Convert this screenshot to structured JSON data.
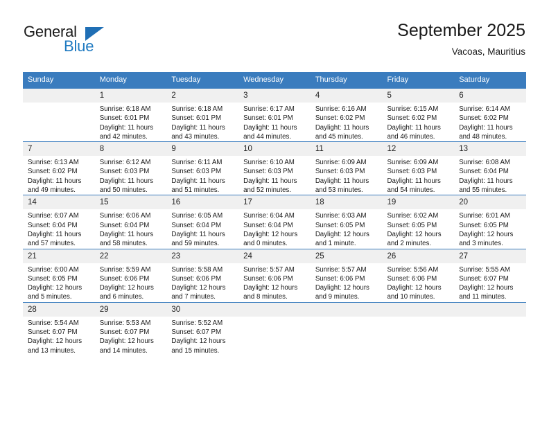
{
  "brand": {
    "word_one": "General",
    "word_two": "Blue",
    "triangle_color": "#1f6fb5",
    "blue_text_color": "#1f7ac1"
  },
  "header": {
    "title": "September 2025",
    "location": "Vacoas, Mauritius"
  },
  "theme": {
    "header_blue": "#3a7cbe",
    "daynum_band": "#f0f0f0",
    "text": "#1a1a1a"
  },
  "weekdays": [
    "Sunday",
    "Monday",
    "Tuesday",
    "Wednesday",
    "Thursday",
    "Friday",
    "Saturday"
  ],
  "weeks": [
    [
      {
        "day": "",
        "blank": true,
        "sunrise": "",
        "sunset": "",
        "daylight": ""
      },
      {
        "day": "1",
        "sunrise": "Sunrise: 6:18 AM",
        "sunset": "Sunset: 6:01 PM",
        "daylight": "Daylight: 11 hours and 42 minutes."
      },
      {
        "day": "2",
        "sunrise": "Sunrise: 6:18 AM",
        "sunset": "Sunset: 6:01 PM",
        "daylight": "Daylight: 11 hours and 43 minutes."
      },
      {
        "day": "3",
        "sunrise": "Sunrise: 6:17 AM",
        "sunset": "Sunset: 6:01 PM",
        "daylight": "Daylight: 11 hours and 44 minutes."
      },
      {
        "day": "4",
        "sunrise": "Sunrise: 6:16 AM",
        "sunset": "Sunset: 6:02 PM",
        "daylight": "Daylight: 11 hours and 45 minutes."
      },
      {
        "day": "5",
        "sunrise": "Sunrise: 6:15 AM",
        "sunset": "Sunset: 6:02 PM",
        "daylight": "Daylight: 11 hours and 46 minutes."
      },
      {
        "day": "6",
        "sunrise": "Sunrise: 6:14 AM",
        "sunset": "Sunset: 6:02 PM",
        "daylight": "Daylight: 11 hours and 48 minutes."
      }
    ],
    [
      {
        "day": "7",
        "sunrise": "Sunrise: 6:13 AM",
        "sunset": "Sunset: 6:02 PM",
        "daylight": "Daylight: 11 hours and 49 minutes."
      },
      {
        "day": "8",
        "sunrise": "Sunrise: 6:12 AM",
        "sunset": "Sunset: 6:03 PM",
        "daylight": "Daylight: 11 hours and 50 minutes."
      },
      {
        "day": "9",
        "sunrise": "Sunrise: 6:11 AM",
        "sunset": "Sunset: 6:03 PM",
        "daylight": "Daylight: 11 hours and 51 minutes."
      },
      {
        "day": "10",
        "sunrise": "Sunrise: 6:10 AM",
        "sunset": "Sunset: 6:03 PM",
        "daylight": "Daylight: 11 hours and 52 minutes."
      },
      {
        "day": "11",
        "sunrise": "Sunrise: 6:09 AM",
        "sunset": "Sunset: 6:03 PM",
        "daylight": "Daylight: 11 hours and 53 minutes."
      },
      {
        "day": "12",
        "sunrise": "Sunrise: 6:09 AM",
        "sunset": "Sunset: 6:03 PM",
        "daylight": "Daylight: 11 hours and 54 minutes."
      },
      {
        "day": "13",
        "sunrise": "Sunrise: 6:08 AM",
        "sunset": "Sunset: 6:04 PM",
        "daylight": "Daylight: 11 hours and 55 minutes."
      }
    ],
    [
      {
        "day": "14",
        "sunrise": "Sunrise: 6:07 AM",
        "sunset": "Sunset: 6:04 PM",
        "daylight": "Daylight: 11 hours and 57 minutes."
      },
      {
        "day": "15",
        "sunrise": "Sunrise: 6:06 AM",
        "sunset": "Sunset: 6:04 PM",
        "daylight": "Daylight: 11 hours and 58 minutes."
      },
      {
        "day": "16",
        "sunrise": "Sunrise: 6:05 AM",
        "sunset": "Sunset: 6:04 PM",
        "daylight": "Daylight: 11 hours and 59 minutes."
      },
      {
        "day": "17",
        "sunrise": "Sunrise: 6:04 AM",
        "sunset": "Sunset: 6:04 PM",
        "daylight": "Daylight: 12 hours and 0 minutes."
      },
      {
        "day": "18",
        "sunrise": "Sunrise: 6:03 AM",
        "sunset": "Sunset: 6:05 PM",
        "daylight": "Daylight: 12 hours and 1 minute."
      },
      {
        "day": "19",
        "sunrise": "Sunrise: 6:02 AM",
        "sunset": "Sunset: 6:05 PM",
        "daylight": "Daylight: 12 hours and 2 minutes."
      },
      {
        "day": "20",
        "sunrise": "Sunrise: 6:01 AM",
        "sunset": "Sunset: 6:05 PM",
        "daylight": "Daylight: 12 hours and 3 minutes."
      }
    ],
    [
      {
        "day": "21",
        "sunrise": "Sunrise: 6:00 AM",
        "sunset": "Sunset: 6:05 PM",
        "daylight": "Daylight: 12 hours and 5 minutes."
      },
      {
        "day": "22",
        "sunrise": "Sunrise: 5:59 AM",
        "sunset": "Sunset: 6:06 PM",
        "daylight": "Daylight: 12 hours and 6 minutes."
      },
      {
        "day": "23",
        "sunrise": "Sunrise: 5:58 AM",
        "sunset": "Sunset: 6:06 PM",
        "daylight": "Daylight: 12 hours and 7 minutes."
      },
      {
        "day": "24",
        "sunrise": "Sunrise: 5:57 AM",
        "sunset": "Sunset: 6:06 PM",
        "daylight": "Daylight: 12 hours and 8 minutes."
      },
      {
        "day": "25",
        "sunrise": "Sunrise: 5:57 AM",
        "sunset": "Sunset: 6:06 PM",
        "daylight": "Daylight: 12 hours and 9 minutes."
      },
      {
        "day": "26",
        "sunrise": "Sunrise: 5:56 AM",
        "sunset": "Sunset: 6:06 PM",
        "daylight": "Daylight: 12 hours and 10 minutes."
      },
      {
        "day": "27",
        "sunrise": "Sunrise: 5:55 AM",
        "sunset": "Sunset: 6:07 PM",
        "daylight": "Daylight: 12 hours and 11 minutes."
      }
    ],
    [
      {
        "day": "28",
        "sunrise": "Sunrise: 5:54 AM",
        "sunset": "Sunset: 6:07 PM",
        "daylight": "Daylight: 12 hours and 13 minutes."
      },
      {
        "day": "29",
        "sunrise": "Sunrise: 5:53 AM",
        "sunset": "Sunset: 6:07 PM",
        "daylight": "Daylight: 12 hours and 14 minutes."
      },
      {
        "day": "30",
        "sunrise": "Sunrise: 5:52 AM",
        "sunset": "Sunset: 6:07 PM",
        "daylight": "Daylight: 12 hours and 15 minutes."
      },
      {
        "day": "",
        "blank": true,
        "sunrise": "",
        "sunset": "",
        "daylight": ""
      },
      {
        "day": "",
        "blank": true,
        "sunrise": "",
        "sunset": "",
        "daylight": ""
      },
      {
        "day": "",
        "blank": true,
        "sunrise": "",
        "sunset": "",
        "daylight": ""
      },
      {
        "day": "",
        "blank": true,
        "sunrise": "",
        "sunset": "",
        "daylight": ""
      }
    ]
  ]
}
